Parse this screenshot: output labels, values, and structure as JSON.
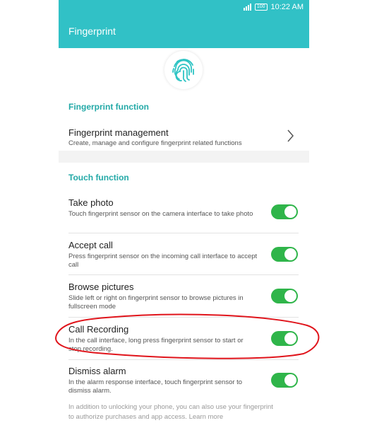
{
  "status_bar": {
    "time": "10:22 AM",
    "battery": "100"
  },
  "header": {
    "title": "Fingerprint"
  },
  "fingerprint_section": {
    "heading": "Fingerprint function",
    "management": {
      "title": "Fingerprint management",
      "desc": "Create, manage and configure fingerprint related functions"
    }
  },
  "touch_section": {
    "heading": "Touch function",
    "items": [
      {
        "title": "Take photo",
        "desc": "Touch fingerprint sensor on the camera interface to take photo",
        "enabled": true
      },
      {
        "title": "Accept call",
        "desc": "Press fingerprint sensor on the incoming call interface to accept call",
        "enabled": true
      },
      {
        "title": "Browse pictures",
        "desc": "Slide left or right on fingerprint sensor to browse pictures in fullscreen mode",
        "enabled": true
      },
      {
        "title": "Call Recording",
        "desc": "In the call interface, long press fingerprint sensor to start or stop recording.",
        "enabled": true
      },
      {
        "title": "Dismiss alarm",
        "desc": "In the alarm response interface, touch fingerprint sensor to dismiss alarm.",
        "enabled": true
      }
    ]
  },
  "footer": {
    "text": "In addition to unlocking your phone, you can also use your fingerprint to authorize purchases and app access. Learn more"
  },
  "colors": {
    "accent": "#31c1c6",
    "section_heading": "#23a9a7",
    "toggle_on": "#2fb54a",
    "annotation": "#e0141b"
  }
}
